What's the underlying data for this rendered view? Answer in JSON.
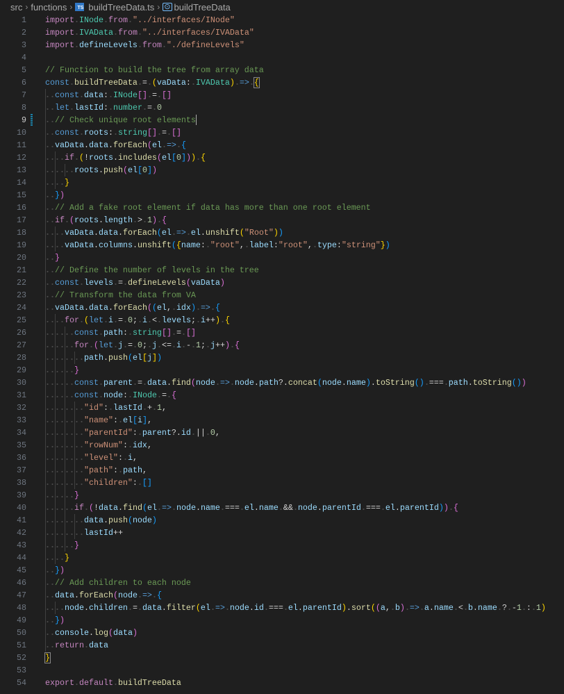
{
  "breadcrumb": {
    "items": [
      "src",
      "functions",
      "buildTreeData.ts",
      "buildTreeData"
    ],
    "file_icon": "TS",
    "symbol_icon": "symbol-variable-icon"
  },
  "editor": {
    "active_line": 9,
    "colors": {
      "keyword": "#C586C0",
      "storage": "#569CD6",
      "type": "#4EC9B0",
      "string": "#CE9178",
      "comment": "#6A9955",
      "function": "#DCDCAA",
      "variable": "#9CDCFE"
    },
    "lines": [
      "import INode from \"../interfaces/INode\"",
      "import IVAData from \"../interfaces/IVAData\"",
      "import defineLevels from \"./defineLevels\"",
      "",
      "// Function to build the tree from array data",
      "const buildTreeData = (vaData: IVAData) => {",
      "  const data: INode[] = []",
      "  let lastId: number = 0",
      "  // Check unique root elements",
      "  const roots: string[] = []",
      "  vaData.data.forEach(el => {",
      "    if (!roots.includes(el[0])) {",
      "      roots.push(el[0])",
      "    }",
      "  })",
      "  // Add a fake root element if data has more than one root element",
      "  if (roots.length > 1) {",
      "    vaData.data.forEach(el => el.unshift(\"Root\"))",
      "    vaData.columns.unshift({name: \"root\", label:\"root\", type:\"string\"})",
      "  }",
      "  // Define the number of levels in the tree",
      "  const levels = defineLevels(vaData)",
      "  // Transform the data from VA",
      "  vaData.data.forEach((el, idx) => {",
      "    for (let i = 0; i < levels; i++) {",
      "      const path: string[] = []",
      "      for (let j = 0; j <= i - 1; j++) {",
      "        path.push(el[j])",
      "      }",
      "      const parent = data.find(node => node.path?.concat(node.name).toString() === path.toString())",
      "      const node: INode = {",
      "        \"id\": lastId + 1,",
      "        \"name\": el[i],",
      "        \"parentId\": parent?.id || 0,",
      "        \"rowNum\": idx,",
      "        \"level\": i,",
      "        \"path\": path,",
      "        \"children\": []",
      "      }",
      "      if (!data.find(el => node.name === el.name && node.parentId === el.parentId)) {",
      "        data.push(node)",
      "        lastId++",
      "      }",
      "    }",
      "  })",
      "  // Add children to each node",
      "  data.forEach(node => {",
      "    node.children = data.filter(el => node.id === el.parentId).sort((a, b) => a.name < b.name ? -1 : 1)",
      "  })",
      "  console.log(data)",
      "  return data",
      "}",
      "",
      "export default buildTreeData"
    ]
  }
}
